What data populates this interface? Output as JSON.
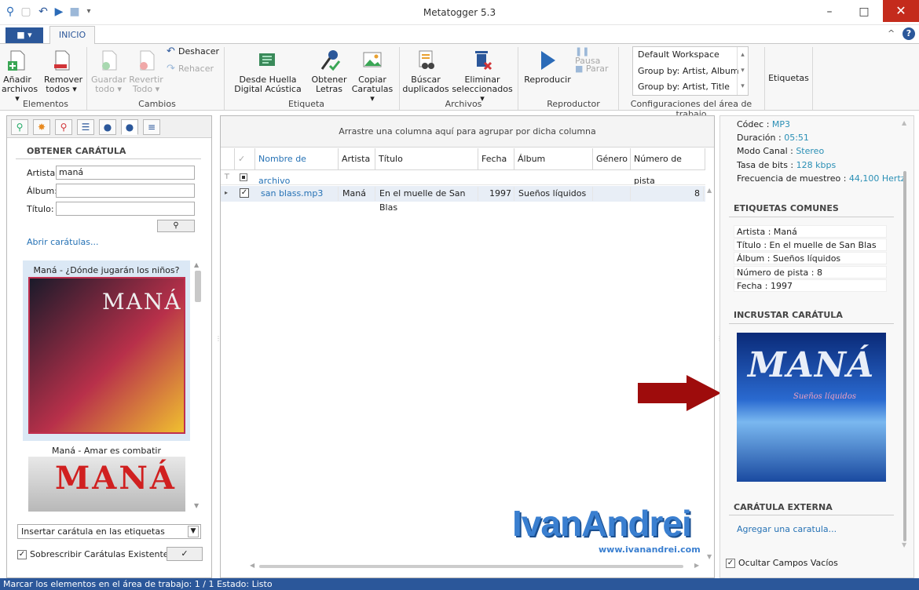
{
  "window": {
    "title": "Metatogger 5.3",
    "minimize": "–",
    "maximize": "□",
    "close": "✕"
  },
  "tabs": {
    "file": "■ ▾",
    "inicio": "INICIO"
  },
  "ribbon": {
    "elementos": {
      "anadir": "Añadir archivos ▾",
      "remover": "Remover todos ▾",
      "group": "Elementos"
    },
    "cambios": {
      "guardar": "Guardar todo ▾",
      "revertir": "Revertir Todo ▾",
      "deshacer": "Deshacer",
      "rehacer": "Rehacer",
      "group": "Cambios"
    },
    "etiqueta": {
      "huella": "Desde Huella Digital Acústica",
      "letras": "Obtener Letras",
      "copiar": "Copiar Caratulas ▾",
      "group": "Etiqueta"
    },
    "archivos": {
      "buscar": "Búscar duplicados",
      "eliminar": "Eliminar seleccionados ▾",
      "group": "Archivos"
    },
    "reproductor": {
      "reproducir": "Reproducir",
      "pausa": "Pausa",
      "parar": "Parar",
      "group": "Reproductor"
    },
    "workspaces": {
      "items": [
        "Default Workspace",
        "Group by: Artist, Album",
        "Group by: Artist, Title"
      ],
      "group": "Configuraciones del área de trabajo"
    },
    "etiquetas": "Etiquetas"
  },
  "left": {
    "header": "OBTENER CARÁTULA",
    "artist_label": "Artista:",
    "artist_value": "maná",
    "album_label": "Álbum:",
    "title_label": "Título:",
    "search_icon": "⚲",
    "open_link": "Abrir carátulas...",
    "cover1_caption": "Maná - ¿Dónde jugarán los niños?",
    "cover1_text": "MANÁ",
    "cover2_caption": "Maná - Amar es combatir",
    "cover2_text": "MANÁ",
    "insert_select": "Insertar carátula en las etiquetas",
    "overwrite_label": "Sobrescribir Carátulas Existentes",
    "apply_btn": "✓"
  },
  "grid": {
    "group_hint": "Arrastre una columna aquí para agrupar por dicha columna",
    "columns": [
      "Nombre de archivo",
      "Artista",
      "Título",
      "Fecha",
      "Álbum",
      "Género",
      "Número de pista"
    ],
    "row": {
      "file": "san blass.mp3",
      "artist": "Maná",
      "title": "En el muelle de San Blas",
      "date": "1997",
      "album": "Sueños líquidos",
      "genre": "",
      "track": "8"
    },
    "watermark": "IvanAndrei",
    "watermark_url": "www.ivanandrei.com"
  },
  "right": {
    "codec_label": "Códec :",
    "codec": "MP3",
    "duration_label": "Duración :",
    "duration": "05:51",
    "mode_label": "Modo Canal :",
    "mode": "Stereo",
    "bitrate_label": "Tasa de bits :",
    "bitrate": "128 kbps",
    "freq_label": "Frecuencia de muestreo :",
    "freq": "44,100 Hertz",
    "common_header": "ETIQUETAS COMUNES",
    "tag_artist": "Artista :  Maná",
    "tag_title": "Título :  En el muelle de San Blas",
    "tag_album": "Álbum :  Sueños líquidos",
    "tag_track": "Número de pista :  8",
    "tag_date": "Fecha :  1997",
    "embed_header": "INCRUSTAR CARÁTULA",
    "cover_text": "MANÁ",
    "cover_sub": "Sueños líquidos",
    "external_header": "CARÁTULA EXTERNA",
    "add_link": "Agregar una caratula...",
    "hide_empty": "Ocultar Campos Vacíos"
  },
  "status": {
    "text": "Marcar los elementos en el área de trabajo: 1 / 1   Estado:  Listo"
  }
}
